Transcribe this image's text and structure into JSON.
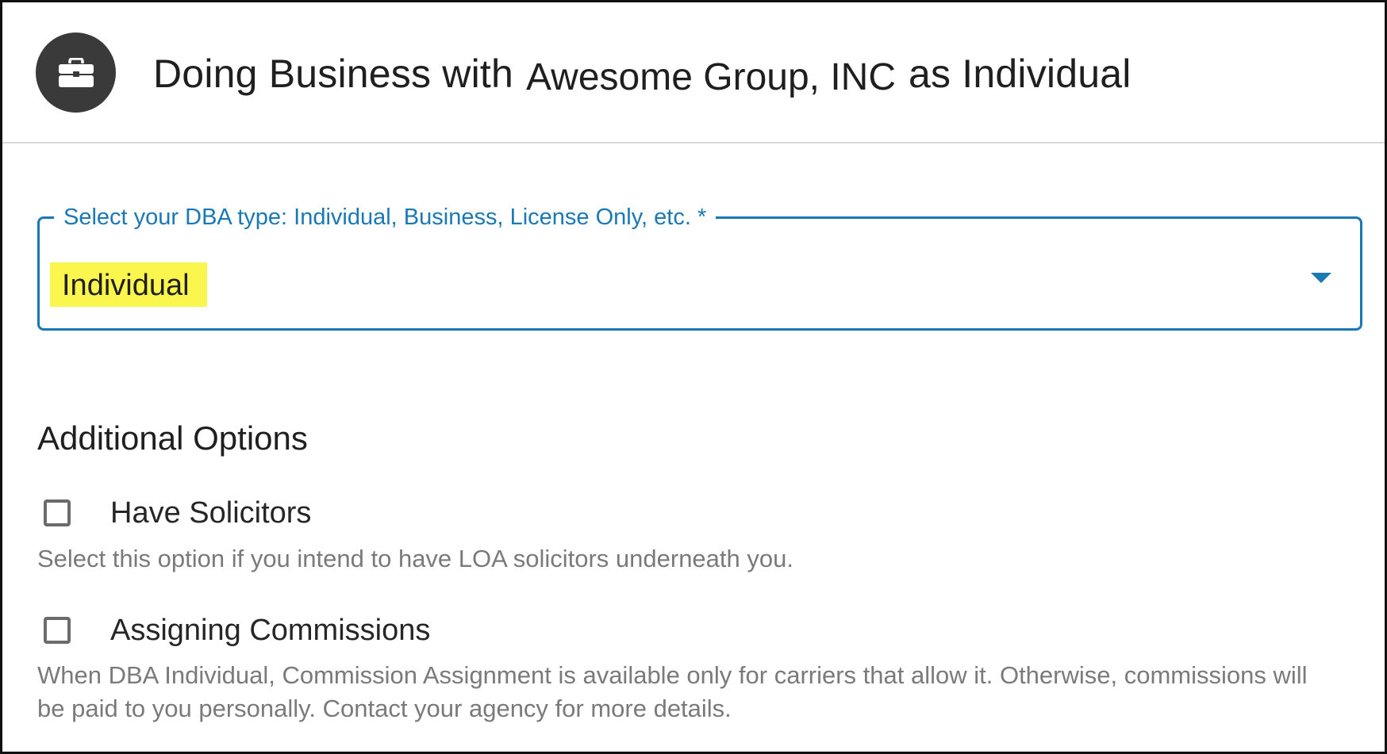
{
  "header": {
    "icon": "briefcase-icon",
    "title_prefix": "Doing Business with",
    "company": "Awesome Group, INC",
    "title_suffix": "as Individual"
  },
  "dba_select": {
    "label": "Select your DBA type: Individual, Business, License Only, etc. *",
    "value": "Individual",
    "highlight_color": "#fbf64e",
    "accent_color": "#1a78b4"
  },
  "additional_options": {
    "title": "Additional Options",
    "options": [
      {
        "label": "Have Solicitors",
        "checked": false,
        "help": "Select this option if you intend to have LOA solicitors underneath you."
      },
      {
        "label": "Assigning Commissions",
        "checked": false,
        "help": "When DBA Individual, Commission Assignment is available only for carriers that allow it. Otherwise, commissions will be paid to you personally. Contact your agency for more details."
      }
    ]
  }
}
